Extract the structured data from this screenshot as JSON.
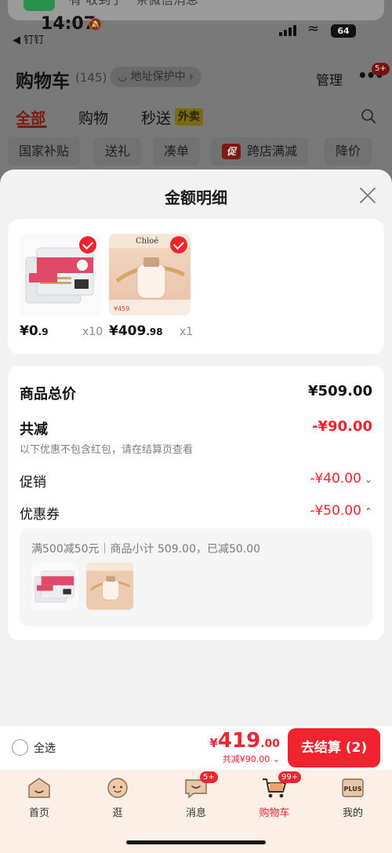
{
  "notification": {
    "text": "有 收到了一条微信消息"
  },
  "status_bar": {
    "time": "14:07",
    "back_label": "◀ 钉钉",
    "battery": "64"
  },
  "header": {
    "title": "购物车",
    "count": "(145)",
    "address_chip": "地址保护中",
    "manage": "管理",
    "more_badge": "5+"
  },
  "tabs": [
    {
      "label": "全部"
    },
    {
      "label": "购物"
    },
    {
      "label": "秒送"
    }
  ],
  "tab_tag": "外卖",
  "filter_chips": [
    "国家补贴",
    "送礼",
    "凑单",
    "跨店满减",
    "降价"
  ],
  "promo_icon": "促",
  "sheet": {
    "title": "金额明细",
    "items": [
      {
        "price_int": "¥0",
        "price_dec": ".9",
        "qty": "x10",
        "image_text": "竹棉棒签"
      },
      {
        "price_int": "¥409",
        "price_dec": ".98",
        "qty": "x1",
        "image_brand": "Chloé",
        "image_tag": "¥459"
      }
    ],
    "summary": {
      "total_label": "商品总价",
      "total_value": "¥509.00",
      "discount_label": "共减",
      "discount_value": "-¥90.00",
      "hint": "以下优惠不包含红包，请在结算页查看",
      "promo_label": "促销",
      "promo_value": "-¥40.00",
      "coupon_label": "优惠券",
      "coupon_value": "-¥50.00",
      "coupon_detail": "满500减50元｜商品小计 509.00，已减50.00"
    }
  },
  "bottom_bar": {
    "select_all": "全选",
    "currency": "¥",
    "total_int": "419",
    "total_dec": ".00",
    "total_sub": "共减¥90.00",
    "checkout": "去结算 (2)"
  },
  "tabbar": {
    "items": [
      {
        "label": "首页",
        "icon": "home-icon"
      },
      {
        "label": "逛",
        "icon": "browse-icon"
      },
      {
        "label": "消息",
        "icon": "message-icon",
        "badge": "5+"
      },
      {
        "label": "购物车",
        "icon": "cart-icon",
        "badge": "99+",
        "active": true
      },
      {
        "label": "我的",
        "icon": "plus-member-icon",
        "icon_text": "PLUS"
      }
    ]
  },
  "colors": {
    "accent": "#f0232f",
    "sheet_bg": "#f2f2f2",
    "tabbar_bg": "#fbefe6"
  }
}
